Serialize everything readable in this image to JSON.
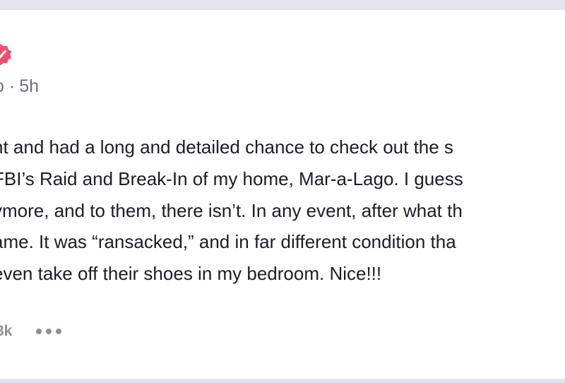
{
  "post": {
    "meta": {
      "handle_fragment": "o",
      "separator": "·",
      "time": "5h"
    },
    "lines": [
      "ht and had a long and detailed chance to check out the s",
      "FBI’s Raid and Break-In of my home, Mar-a-Lago. I guess",
      "ymore, and to them, there isn’t. In any event, after what th",
      "ame. It was “ransacked,” and in far different condition tha",
      "even take off their shoes in my bedroom. Nice!!!"
    ],
    "actions": {
      "count": "3k",
      "more_icon": "more-dots-icon"
    }
  },
  "colors": {
    "page_background": "#e4e3ef",
    "card_background": "#ffffff",
    "text": "#1c1b2b",
    "muted": "#6f6e7c",
    "badge": "#f0506e"
  }
}
